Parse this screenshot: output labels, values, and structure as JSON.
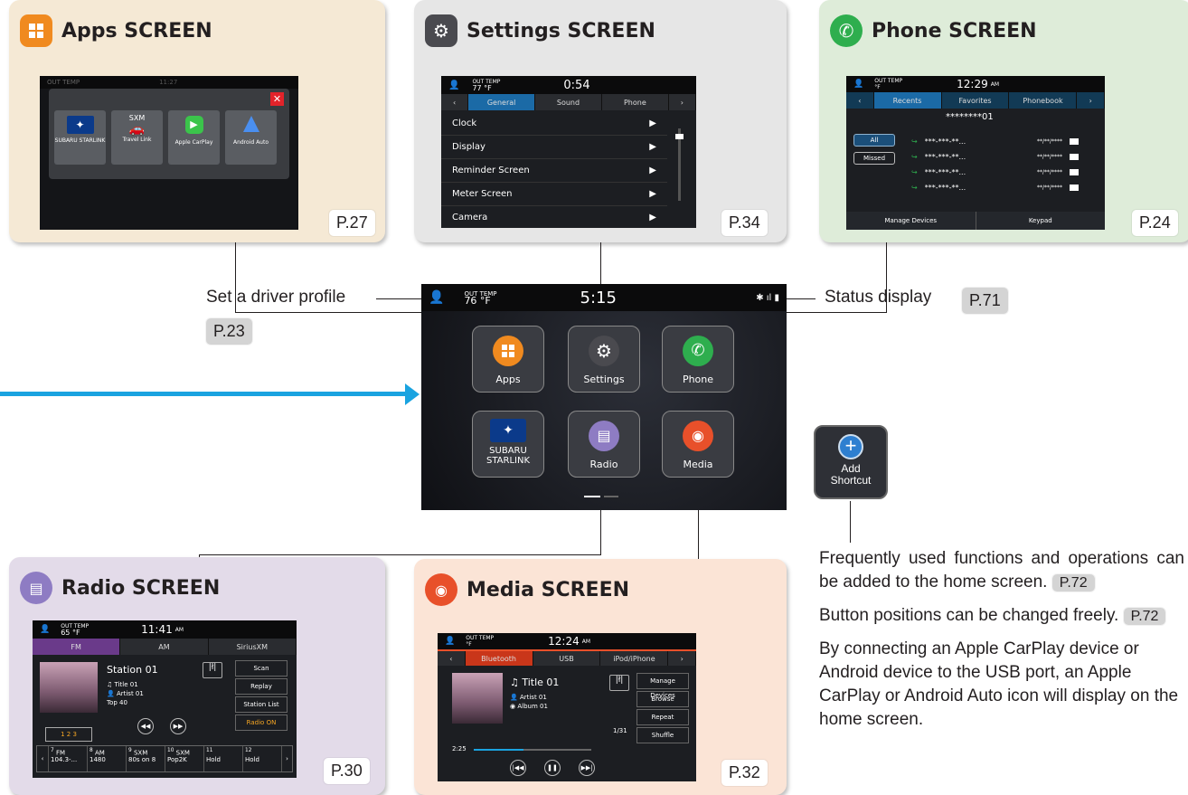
{
  "panels": {
    "apps": {
      "title": "Apps SCREEN",
      "page": "P.27"
    },
    "settings": {
      "title": "Settings SCREEN",
      "page": "P.34"
    },
    "phone": {
      "title": "Phone SCREEN",
      "page": "P.24"
    },
    "radio": {
      "title": "Radio SCREEN",
      "page": "P.30"
    },
    "media": {
      "title": "Media SCREEN",
      "page": "P.32"
    }
  },
  "apps_screen": {
    "status_temp": "OUT TEMP",
    "time": "11:27",
    "tiles": [
      "SUBARU STARLINK",
      "Travel Link",
      "Apple CarPlay",
      "Android Auto"
    ],
    "sxm": "SXM"
  },
  "settings_screen": {
    "temp_label": "OUT TEMP",
    "temp": "77 °F",
    "time": "0:54",
    "tabs": [
      "General",
      "Sound",
      "Phone"
    ],
    "rows": [
      "Clock",
      "Display",
      "Reminder Screen",
      "Meter Screen",
      "Camera"
    ]
  },
  "phone_screen": {
    "temp_label": "OUT TEMP",
    "temp": "°F",
    "time": "12:29",
    "ampm": "AM",
    "tabs": [
      "Recents",
      "Favorites",
      "Phonebook"
    ],
    "number_header": "********01",
    "filters": [
      "All",
      "Missed"
    ],
    "calls": [
      {
        "number": "***-***-**...",
        "date": "**/**/****"
      },
      {
        "number": "***-***-**...",
        "date": "**/**/****"
      },
      {
        "number": "***-***-**...",
        "date": "**/**/****"
      },
      {
        "number": "***-***-**...",
        "date": "**/**/****"
      }
    ],
    "bottom": [
      "Manage Devices",
      "Keypad"
    ]
  },
  "home": {
    "temp_label": "OUT TEMP",
    "temp": "76 °F",
    "time": "5:15",
    "tiles": [
      "Apps",
      "Settings",
      "Phone",
      "SUBARU STARLINK",
      "Radio",
      "Media"
    ]
  },
  "callouts": {
    "driver_profile": "Set a driver profile",
    "driver_profile_page": "P.23",
    "status_display": "Status display",
    "status_display_page": "P.71"
  },
  "shortcut": {
    "label": "Add Shortcut"
  },
  "notes": {
    "p1": "Frequently used functions and operations can be added to the home screen.",
    "p1_page": "P.72",
    "p2": "Button positions can be changed freely.",
    "p2_page": "P.72",
    "p3": "By connecting an Apple CarPlay device or Android device to the USB port, an Apple CarPlay or Android Auto icon will display on the home screen."
  },
  "radio_screen": {
    "temp_label": "OUT TEMP",
    "temp": "65 °F",
    "time": "11:41",
    "ampm": "AM",
    "tabs": [
      "FM",
      "AM",
      "SiriusXM"
    ],
    "station": "Station 01",
    "title": "Title 01",
    "artist": "Artist 01",
    "genre": "Top 40",
    "side": [
      "Scan",
      "Replay",
      "Station List",
      "Radio ON"
    ],
    "presets": [
      {
        "num": "7",
        "band": "FM",
        "name": "104.3-..."
      },
      {
        "num": "8",
        "band": "AM",
        "name": "1480"
      },
      {
        "num": "9",
        "band": "SXM",
        "name": "80s on 8"
      },
      {
        "num": "10",
        "band": "SXM",
        "name": "Pop2K"
      },
      {
        "num": "11",
        "band": "",
        "name": "Hold"
      },
      {
        "num": "12",
        "band": "",
        "name": "Hold"
      }
    ],
    "preset_page": "1 2 3"
  },
  "media_screen": {
    "temp_label": "OUT TEMP",
    "temp": "°F",
    "time": "12:24",
    "ampm": "AM",
    "tabs": [
      "Bluetooth",
      "USB",
      "iPod/iPhone"
    ],
    "title": "Title 01",
    "artist": "Artist 01",
    "album": "Album 01",
    "track": "1/31",
    "elapsed": "2:25",
    "progress": 0.42,
    "side": [
      "Manage Devices",
      "Browse",
      "Repeat",
      "Shuffle"
    ]
  },
  "colors": {
    "apps_bg": "#f5e9d5",
    "settings_bg": "#e6e6e6",
    "phone_bg": "#deecd9",
    "radio_bg": "#e3dbe9",
    "media_bg": "#fbe4d6",
    "arrow": "#1aa3e0",
    "apps_icon": "#f08a1f",
    "phone_icon": "#2eae4e",
    "radio_icon": "#8e7cc3",
    "media_icon": "#e8502a"
  }
}
